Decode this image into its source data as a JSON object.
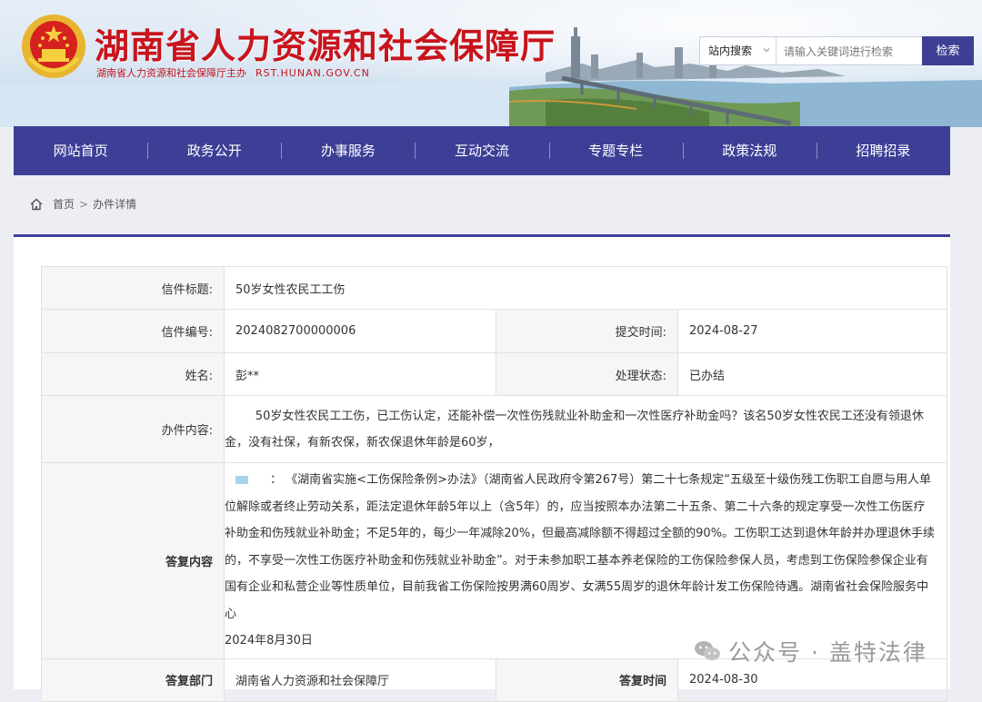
{
  "header": {
    "title": "湖南省人力资源和社会保障厅",
    "sponsor": "湖南省人力资源和社会保障厅主办",
    "domain": "RST.HUNAN.GOV.CN"
  },
  "search": {
    "scope": "站内搜索",
    "placeholder": "请输入关键词进行检索",
    "button": "检索"
  },
  "nav": [
    "网站首页",
    "政务公开",
    "办事服务",
    "互动交流",
    "专题专栏",
    "政策法规",
    "招聘招录"
  ],
  "breadcrumb": {
    "home": "首页",
    "sep": ">",
    "current": "办件详情"
  },
  "letter": {
    "title_label": "信件标题:",
    "title": "50岁女性农民工工伤",
    "number_label": "信件编号:",
    "number": "2024082700000006",
    "submit_label": "提交时间:",
    "submit_time": "2024-08-27",
    "name_label": "姓名:",
    "name": "彭**",
    "status_label": "处理状态:",
    "status": "已办结",
    "content_label": "办件内容:",
    "content": "50岁女性农民工工伤，已工伤认定，还能补偿一次性伤残就业补助金和一次性医疗补助金吗？该名50岁女性农民工还没有领退休金，没有社保，有新农保，新农保退休年龄是60岁，",
    "reply_label": "答复内容",
    "reply_lead": "：",
    "reply": "《湖南省实施<工伤保险条例>办法》（湖南省人民政府令第267号）第二十七条规定“五级至十级伤残工伤职工自愿与用人单位解除或者终止劳动关系，距法定退休年龄5年以上（含5年）的，应当按照本办法第二十五条、第二十六条的规定享受一次性工伤医疗补助金和伤残就业补助金；不足5年的，每少一年减除20%，但最高减除额不得超过全额的90%。工伤职工达到退休年龄并办理退休手续的，不享受一次性工伤医疗补助金和伤残就业补助金”。对于未参加职工基本养老保险的工伤保险参保人员，考虑到工伤保险参保企业有国有企业和私营企业等性质单位，目前我省工伤保险按男满60周岁、女满55周岁的退休年龄计发工伤保险待遇。湖南省社会保险服务中心",
    "reply_date": "2024年8月30日",
    "dept_label": "答复部门",
    "dept": "湖南省人力资源和社会保障厅",
    "reply_time_label": "答复时间",
    "reply_time": "2024-08-30"
  },
  "watermark": "公众号 · 盖特法律",
  "colors": {
    "brand_red": "#c8141c",
    "nav_blue": "#3d3f96"
  }
}
